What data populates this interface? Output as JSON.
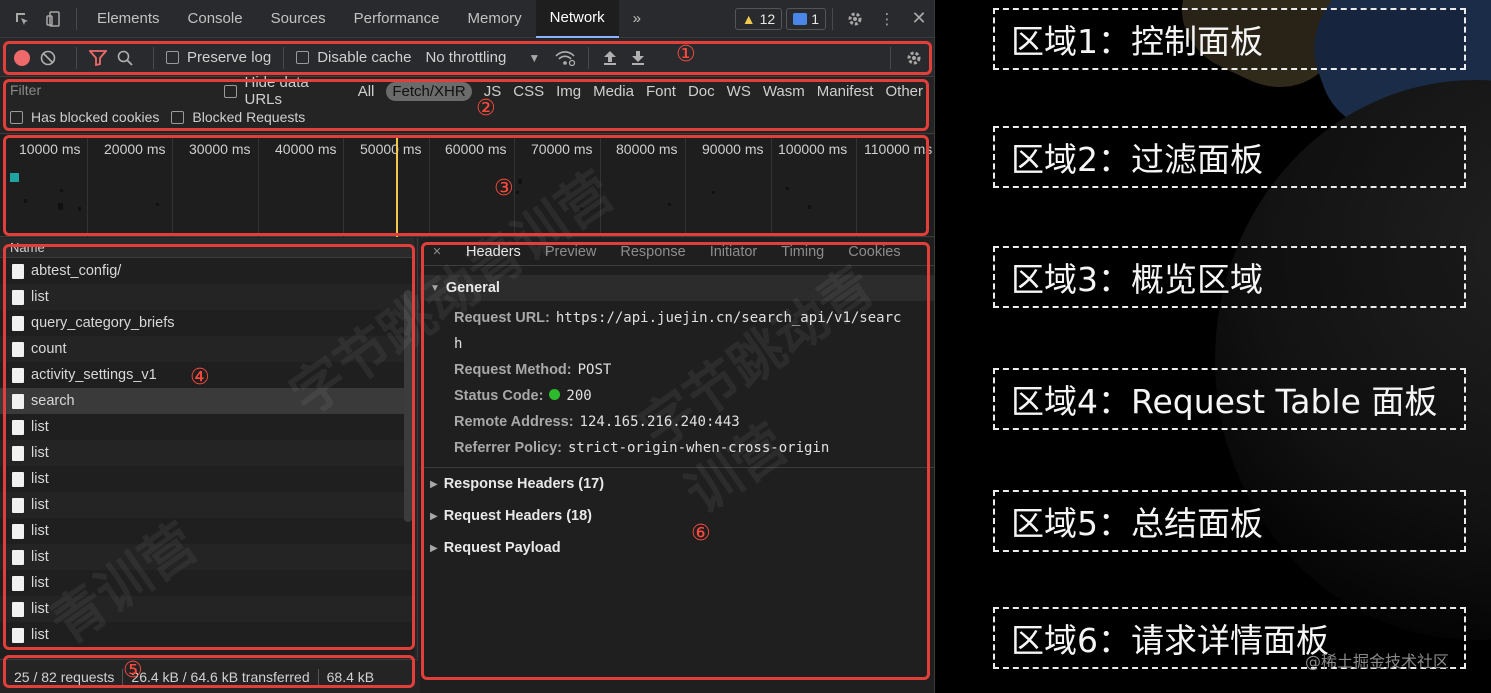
{
  "devtools": {
    "tabs": [
      "Elements",
      "Console",
      "Sources",
      "Performance",
      "Memory",
      "Network"
    ],
    "active_tab": "Network",
    "more_tabs": "»",
    "warnings_count": "12",
    "messages_count": "1"
  },
  "control": {
    "preserve_log": "Preserve log",
    "disable_cache": "Disable cache",
    "throttling": "No throttling",
    "marker": "①"
  },
  "filter": {
    "placeholder": "Filter",
    "hide_data_urls": "Hide data URLs",
    "types": [
      "All",
      "Fetch/XHR",
      "JS",
      "CSS",
      "Img",
      "Media",
      "Font",
      "Doc",
      "WS",
      "Wasm",
      "Manifest",
      "Other"
    ],
    "active_type": "Fetch/XHR",
    "has_blocked_cookies": "Has blocked cookies",
    "blocked_requests": "Blocked Requests",
    "marker": "②"
  },
  "overview": {
    "ticks": [
      "10000 ms",
      "20000 ms",
      "30000 ms",
      "40000 ms",
      "50000 ms",
      "60000 ms",
      "70000 ms",
      "80000 ms",
      "90000 ms",
      "100000 ms",
      "110000 ms"
    ],
    "marker": "③"
  },
  "requests": {
    "column": "Name",
    "rows": [
      "abtest_config/",
      "list",
      "query_category_briefs",
      "count",
      "activity_settings_v1",
      "search",
      "list",
      "list",
      "list",
      "list",
      "list",
      "list",
      "list",
      "list",
      "list"
    ],
    "selected_index": 5,
    "marker": "④"
  },
  "details": {
    "close": "×",
    "tabs": [
      "Headers",
      "Preview",
      "Response",
      "Initiator",
      "Timing",
      "Cookies"
    ],
    "active_tab": "Headers",
    "general_title": "General",
    "request_url_label": "Request URL:",
    "request_url_value": "https://api.juejin.cn/search_api/v1/searc",
    "request_url_wrap": "h",
    "request_method_label": "Request Method:",
    "request_method_value": "POST",
    "status_code_label": "Status Code:",
    "status_code_value": "200",
    "remote_address_label": "Remote Address:",
    "remote_address_value": "124.165.216.240:443",
    "referrer_policy_label": "Referrer Policy:",
    "referrer_policy_value": "strict-origin-when-cross-origin",
    "response_headers": "Response Headers (17)",
    "request_headers": "Request Headers (18)",
    "request_payload": "Request Payload",
    "marker": "⑥"
  },
  "summary": {
    "requests": "25 / 82 requests",
    "transferred": "26.4 kB / 64.6 kB transferred",
    "resources": "68.4 kB",
    "marker": "⑤"
  },
  "legend": [
    "区域1：控制面板",
    "区域2：过滤面板",
    "区域3：概览区域",
    "区域4：Request Table 面板",
    "区域5：总结面板",
    "区域6：请求详情面板"
  ],
  "watermark": "@稀土掘金技术社区",
  "colors": {
    "highlight": "#e23f3a",
    "record": "#ee6a6a",
    "status_ok": "#2dbb2d",
    "warning": "#f2c94c"
  }
}
